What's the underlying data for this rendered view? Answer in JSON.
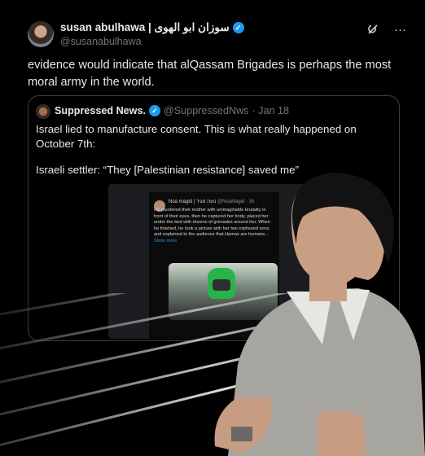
{
  "author": {
    "name": "susan abulhawa | سوزان ابو الهوى",
    "handle": "@susanabulhawa",
    "verified_glyph": "✓"
  },
  "actions": {
    "grok_icon": "grok-icon",
    "more_label": "···"
  },
  "tweet": {
    "text": "evidence would indicate that alQassam Brigades is perhaps the most moral army in the world."
  },
  "quote": {
    "name": "Suppressed News.",
    "handle": "@SuppressedNws",
    "date": "· Jan 18",
    "line1": "Israel lied to manufacture consent. This is what really happened on October 7th:",
    "line2": "Israeli settler: “They [Palestinian resistance] saved me”",
    "embedded": {
      "name": "Noa magid | נועה מגיד",
      "handle": "@NoaMagid · 3h",
      "body": "He murdered their mother with unimaginable brutality in front of their eyes, then he captured her body, placed her under the bed with dozens of grenades around her. When he finished, he took a picture with her two orphaned sons and explained to the audience that Hamas are humane...",
      "more": "Show more"
    }
  },
  "colors": {
    "accent": "#1d9bf0",
    "bg": "#000000",
    "text": "#e7e9ea",
    "muted": "#71767b"
  }
}
